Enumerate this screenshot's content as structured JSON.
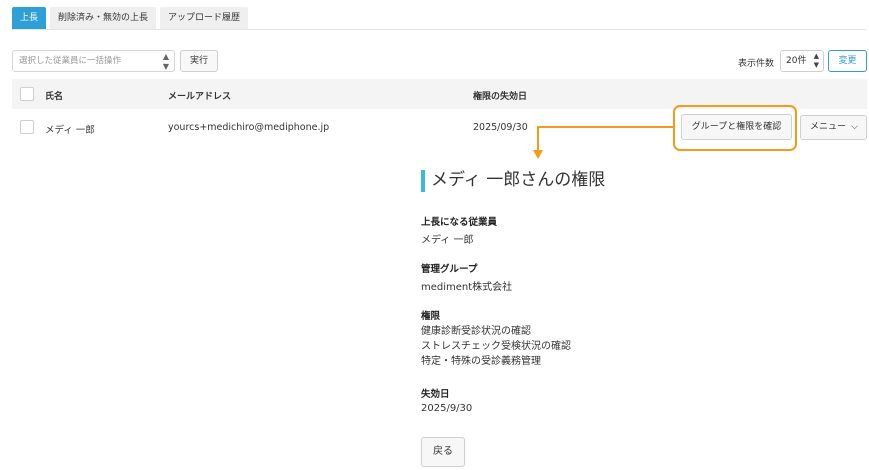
{
  "tabs": [
    {
      "label": "上長",
      "active": true
    },
    {
      "label": "削除済み・無効の上長",
      "active": false
    },
    {
      "label": "アップロード履歴",
      "active": false
    }
  ],
  "toolbar": {
    "bulk_placeholder": "選択した従業員に一括操作",
    "exec_label": "実行",
    "count_label": "表示件数",
    "count_value": "20件",
    "change_label": "変更"
  },
  "table": {
    "headers": {
      "name": "氏名",
      "email": "メールアドレス",
      "expiry": "権限の失効日"
    },
    "rows": [
      {
        "name": "メディ 一郎",
        "email": "yourcs+medichiro@mediphone.jp",
        "expiry": "2025/09/30",
        "confirm_label": "グループと権限を確認",
        "menu_label": "メニュー"
      }
    ]
  },
  "detail": {
    "title": "メディ 一郎さんの権限",
    "superior_label": "上長になる従業員",
    "superior_value": "メディ 一郎",
    "group_label": "管理グループ",
    "group_value": "mediment株式会社",
    "permissions_label": "権限",
    "permissions": [
      "健康診断受診状況の確認",
      "ストレスチェック受検状況の確認",
      "特定・特殊の受診義務管理"
    ],
    "expiry_label": "失効日",
    "expiry_value": "2025/9/30",
    "back_label": "戻る"
  },
  "colors": {
    "accent": "#2f9fd8",
    "highlight": "#f39b1a",
    "title_bar": "#3fb8d5"
  },
  "icons": {
    "updown": "updown-arrows-icon",
    "chevron": "chevron-down-icon"
  }
}
